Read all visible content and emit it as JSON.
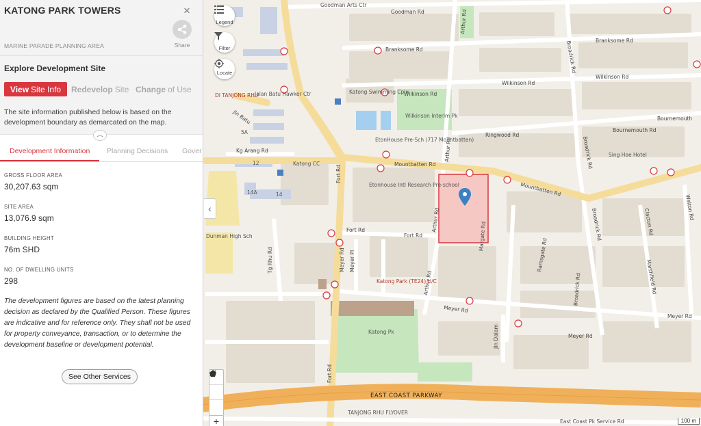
{
  "panel": {
    "title": "KATONG PARK TOWERS",
    "close_symbol": "×",
    "share_label": "Share",
    "planning_area": "MARINE PARADE PLANNING AREA",
    "explore_title": "Explore Development Site",
    "modes": [
      {
        "strong": "View",
        "rest": "Site Info",
        "active": true
      },
      {
        "strong": "Redevelop",
        "rest": "Site",
        "active": false
      },
      {
        "strong": "Change",
        "rest": "of Use",
        "active": false
      }
    ],
    "site_note": "The site information published below is based on the development boundary as demarcated on the map.",
    "tabs": [
      "Development Information",
      "Planning Decisions",
      "Gover"
    ],
    "info": [
      {
        "label": "GROSS FLOOR AREA",
        "value": "30,207.63 sqm"
      },
      {
        "label": "SITE AREA",
        "value": "13,076.9 sqm"
      },
      {
        "label": "BUILDING HEIGHT",
        "value": "76m SHD"
      },
      {
        "label": "NO. OF DWELLING UNITS",
        "value": "298"
      }
    ],
    "disclaimer": "The development figures are based on the latest planning decision as declared by the Qualified Person. These figures are indicative and for reference only. They shall not be used for property conveyance, transaction, or to determine the development baseline or development potential.",
    "services_button": "See Other Services"
  },
  "map_controls": {
    "legend": "Legend",
    "filter": "Filter",
    "locate": "Locate",
    "zoom_in": "+",
    "scale": "100 m"
  },
  "map_labels": {
    "roads": {
      "goodman": "Goodman Rd",
      "branksome": "Branksome Rd",
      "wilkinson": "Wilkinson Rd",
      "ringwood": "Ringwood Rd",
      "bournemouth": "Bournemouth Rd",
      "bournemouth2": "Bournemouth",
      "mountbatten": "Mountbatten Rd",
      "fort": "Fort Rd",
      "meyer": "Meyer Rd",
      "kg_arang": "Kg Arang Rd",
      "arthur": "Arthur Rd",
      "broadrick": "Broadrick Rd",
      "margate": "Margate Rd",
      "ramsgate": "Ramsgate Rd",
      "clacton": "Clacton Rd",
      "marshfield": "Marshfield Rd",
      "walton": "Walton Rd",
      "meyer_pl": "Meyer Pl",
      "jln_dalam": "Jln Dalam",
      "tg_rhu": "Tg Rhu Rd",
      "jln_batu": "Jln Batu",
      "east_coast_pk_service": "East Coast Pk Service Rd",
      "expressway": "EAST COAST PARKWAY",
      "tanjong_rhu_flyover": "TANJONG RHU FLYOVER"
    },
    "places": {
      "goodman_arts": "Goodman Arts Ctr",
      "jalan_batu_hawker": "Jalan Batu Hawker Ctr",
      "di_tanjong_rhu": "DI TANJONG RHU",
      "katong_swimming": "Katong Swimming Cplx",
      "wilkinson_park": "Wilkinson Interim Pk",
      "etonhouse_preschool": "EtonHouse Pre-Sch (717 Mountbatten)",
      "etonhouse_intl": "Etonhouse Intl Research Pre-school",
      "katong_cc": "Katong CC",
      "dunman_high": "Dunman High Sch",
      "katong_park_station": "Katong Park (TE24) U/C",
      "katong_pk": "Katong Pk",
      "sing_hoe_hotel": "Sing Hoe Hotel",
      "blk_12": "12",
      "blk_14": "14",
      "blk_14a": "14A",
      "blk_5a": "5A"
    }
  },
  "colors": {
    "accent": "#d9363e",
    "site_fill": "#f6c8c3",
    "site_border": "#d9363e",
    "marker": "#3b82c4",
    "major_road": "#f5dc9a",
    "expressway": "#f0b05a",
    "park": "#c6e6bd"
  }
}
